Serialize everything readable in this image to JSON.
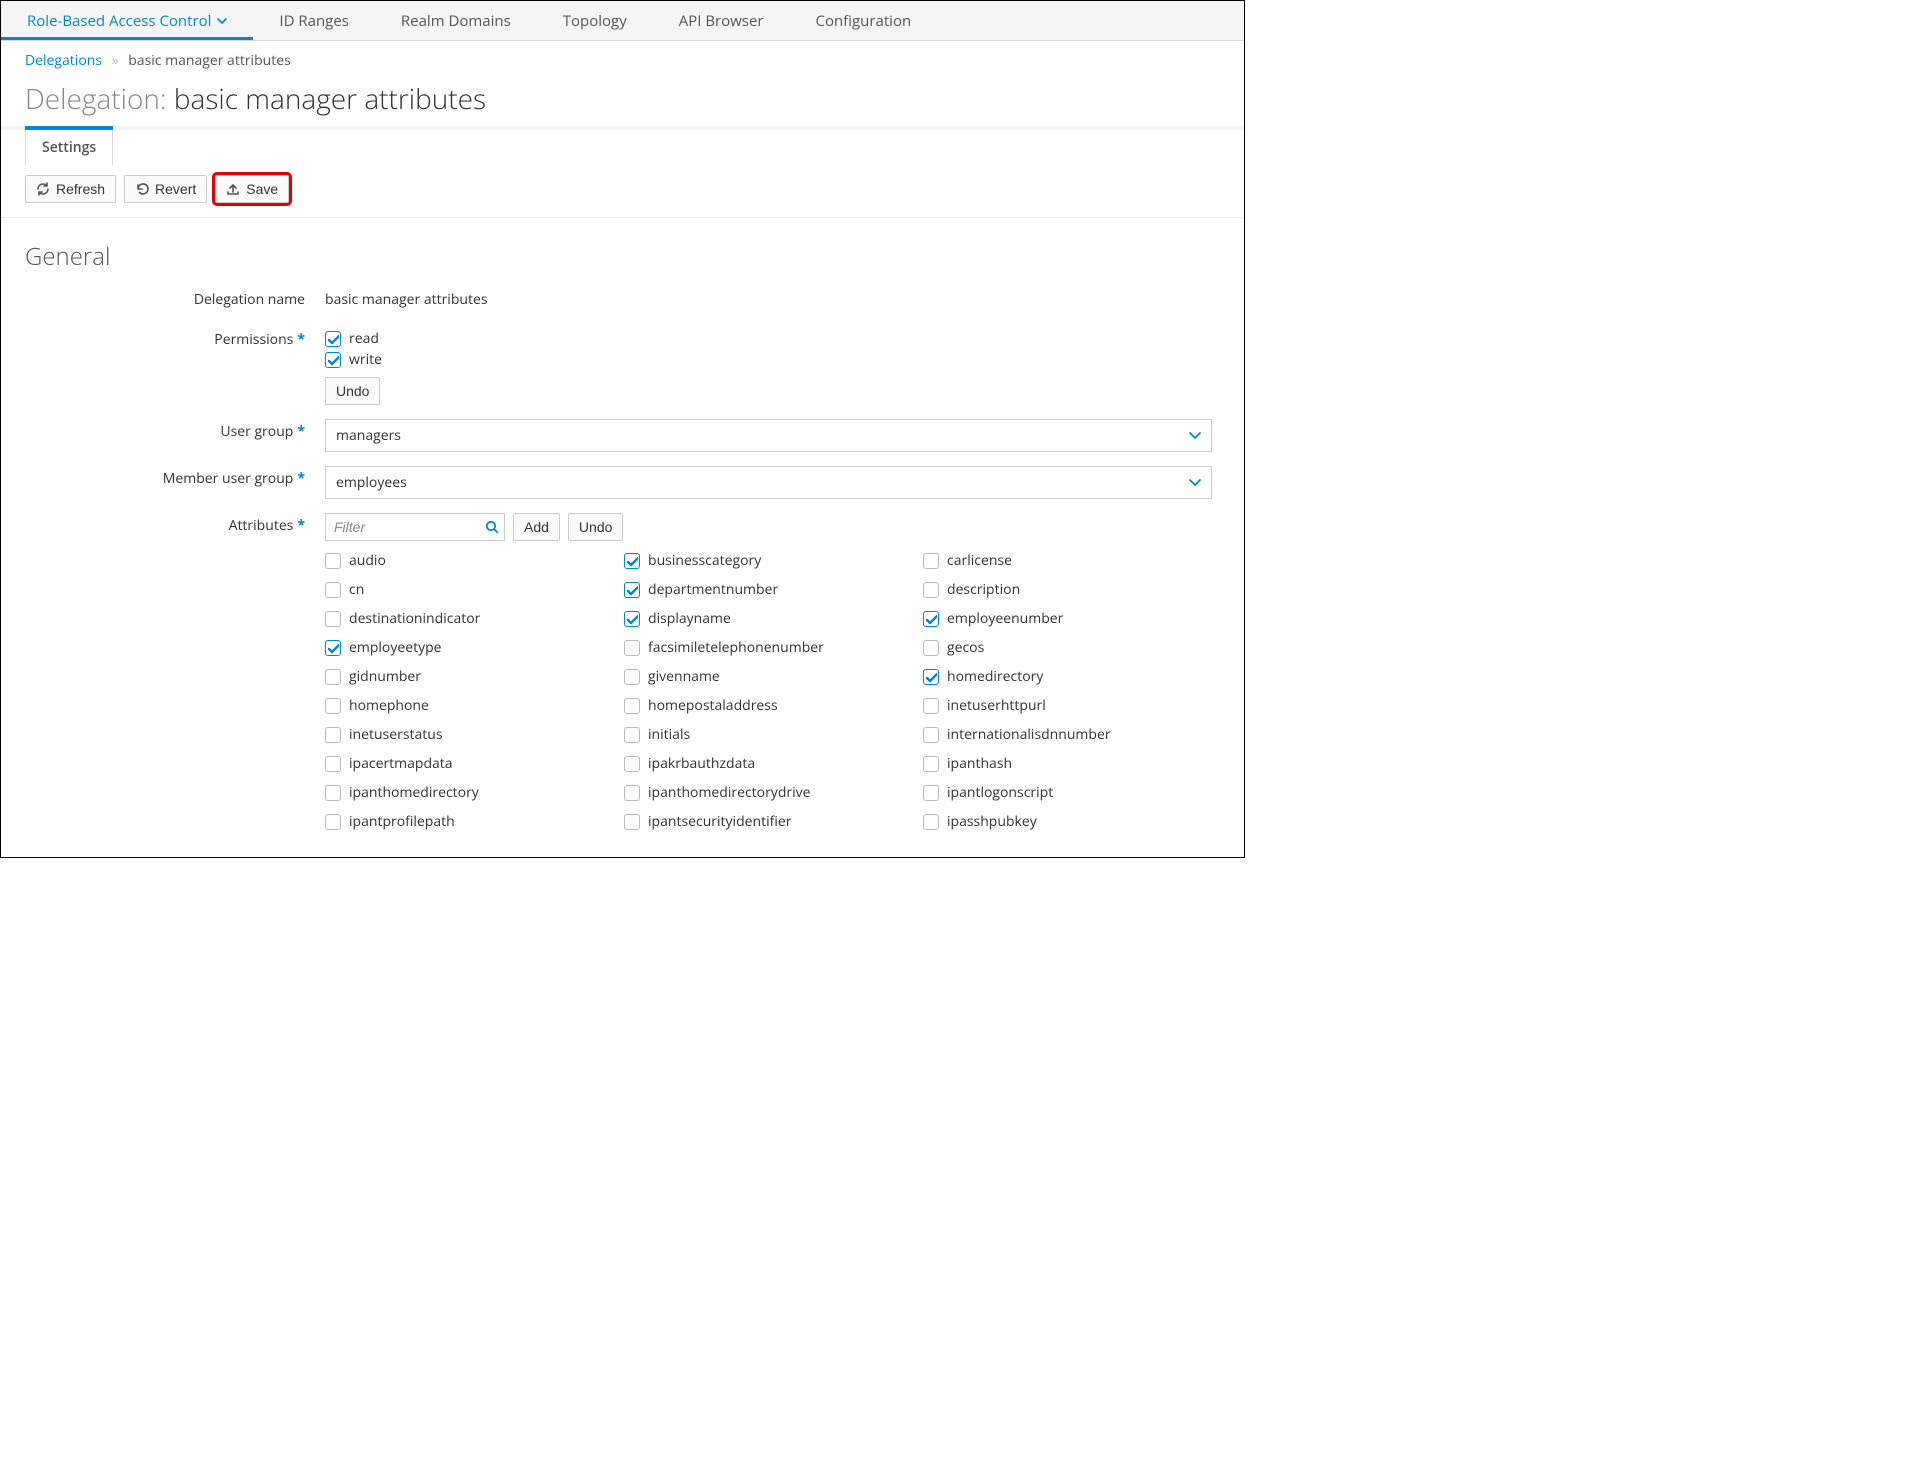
{
  "nav": {
    "items": [
      {
        "label": "Role-Based Access Control",
        "active": true,
        "dropdown": true
      },
      {
        "label": "ID Ranges"
      },
      {
        "label": "Realm Domains"
      },
      {
        "label": "Topology"
      },
      {
        "label": "API Browser"
      },
      {
        "label": "Configuration"
      }
    ]
  },
  "breadcrumb": {
    "parent": "Delegations",
    "current": "basic manager attributes"
  },
  "title": {
    "prefix": "Delegation:",
    "entity": "basic manager attributes"
  },
  "tabs": [
    {
      "label": "Settings",
      "active": true
    }
  ],
  "toolbar": {
    "refresh": "Refresh",
    "revert": "Revert",
    "save": "Save"
  },
  "section_general": "General",
  "labels": {
    "delegation_name": "Delegation name",
    "permissions": "Permissions",
    "user_group": "User group",
    "member_user_group": "Member user group",
    "attributes": "Attributes"
  },
  "values": {
    "delegation_name": "basic manager attributes",
    "user_group": "managers",
    "member_user_group": "employees"
  },
  "permissions": {
    "options": [
      {
        "name": "read",
        "checked": true
      },
      {
        "name": "write",
        "checked": true
      }
    ],
    "undo": "Undo"
  },
  "filter": {
    "placeholder": "Filter",
    "add": "Add",
    "undo": "Undo"
  },
  "attributes": [
    {
      "name": "audio",
      "checked": false
    },
    {
      "name": "businesscategory",
      "checked": true
    },
    {
      "name": "carlicense",
      "checked": false
    },
    {
      "name": "cn",
      "checked": false
    },
    {
      "name": "departmentnumber",
      "checked": true
    },
    {
      "name": "description",
      "checked": false
    },
    {
      "name": "destinationindicator",
      "checked": false
    },
    {
      "name": "displayname",
      "checked": true
    },
    {
      "name": "employeenumber",
      "checked": true
    },
    {
      "name": "employeetype",
      "checked": true
    },
    {
      "name": "facsimiletelephonenumber",
      "checked": false
    },
    {
      "name": "gecos",
      "checked": false
    },
    {
      "name": "gidnumber",
      "checked": false
    },
    {
      "name": "givenname",
      "checked": false
    },
    {
      "name": "homedirectory",
      "checked": true
    },
    {
      "name": "homephone",
      "checked": false
    },
    {
      "name": "homepostaladdress",
      "checked": false
    },
    {
      "name": "inetuserhttpurl",
      "checked": false
    },
    {
      "name": "inetuserstatus",
      "checked": false
    },
    {
      "name": "initials",
      "checked": false
    },
    {
      "name": "internationalisdnnumber",
      "checked": false
    },
    {
      "name": "ipacertmapdata",
      "checked": false
    },
    {
      "name": "ipakrbauthzdata",
      "checked": false
    },
    {
      "name": "ipanthash",
      "checked": false
    },
    {
      "name": "ipanthomedirectory",
      "checked": false
    },
    {
      "name": "ipanthomedirectorydrive",
      "checked": false
    },
    {
      "name": "ipantlogonscript",
      "checked": false
    },
    {
      "name": "ipantprofilepath",
      "checked": false
    },
    {
      "name": "ipantsecurityidentifier",
      "checked": false
    },
    {
      "name": "ipasshpubkey",
      "checked": false
    }
  ]
}
